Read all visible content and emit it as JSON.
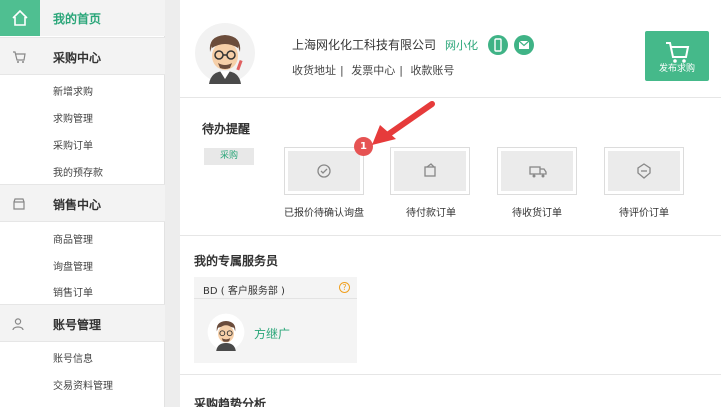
{
  "sidebar": {
    "home_label": "我的首页",
    "sections": [
      {
        "label": "采购中心",
        "items": [
          "新增求购",
          "求购管理",
          "采购订单",
          "我的预存款"
        ]
      },
      {
        "label": "销售中心",
        "items": [
          "商品管理",
          "询盘管理",
          "销售订单"
        ]
      },
      {
        "label": "账号管理",
        "items": [
          "账号信息",
          "交易资料管理"
        ]
      }
    ]
  },
  "profile": {
    "company": "上海网化化工科技有限公司",
    "nickname": "网小化",
    "links": [
      "收货地址",
      "发票中心",
      "收款账号"
    ],
    "separator": "|"
  },
  "publish_button": "发布求购",
  "todo": {
    "title": "待办提醒",
    "tag": "采购",
    "badge": "1",
    "items": [
      {
        "label": "已报价待确认询盘",
        "icon": "check-circle-icon"
      },
      {
        "label": "待付款订单",
        "icon": "payment-icon"
      },
      {
        "label": "待收货订单",
        "icon": "truck-icon"
      },
      {
        "label": "待评价订单",
        "icon": "rating-icon"
      }
    ]
  },
  "service": {
    "title": "我的专属服务员",
    "card_header": "BD ( 客户服务部 )",
    "rep_name": "方继广"
  },
  "trend_title": "采购趋势分析",
  "colors": {
    "accent": "#45b98a",
    "badge": "#e65353",
    "arrow": "#e63b3b"
  }
}
